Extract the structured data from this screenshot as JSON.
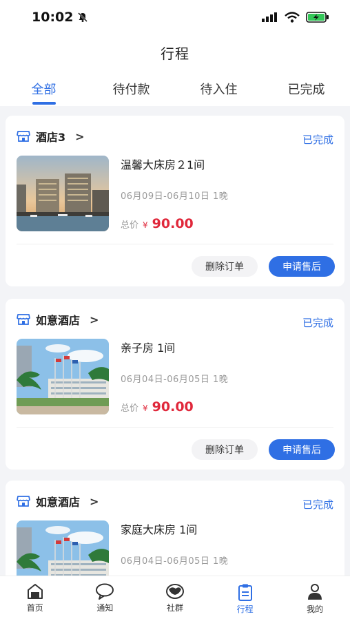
{
  "status_bar": {
    "time": "10:02"
  },
  "header": {
    "title": "行程"
  },
  "tabs": [
    {
      "label": "全部",
      "active": true
    },
    {
      "label": "待付款",
      "active": false
    },
    {
      "label": "待入住",
      "active": false
    },
    {
      "label": "已完成",
      "active": false
    }
  ],
  "orders": [
    {
      "hotel": "酒店3",
      "status": "已完成",
      "room": "温馨大床房２1间",
      "dates": "06月09日-06月10日 1晚",
      "price_label": "总价",
      "currency": "¥",
      "price": "90.00",
      "delete_label": "删除订单",
      "after_sale_label": "申请售后",
      "image": "hotel-towers-waterfront"
    },
    {
      "hotel": "如意酒店",
      "status": "已完成",
      "room": "亲子房 1间",
      "dates": "06月04日-06月05日 1晚",
      "price_label": "总价",
      "currency": "¥",
      "price": "90.00",
      "delete_label": "删除订单",
      "after_sale_label": "申请售后",
      "image": "hotel-palms-flags"
    },
    {
      "hotel": "如意酒店",
      "status": "已完成",
      "room": "家庭大床房 1间",
      "dates": "06月04日-06月05日 1晚",
      "image": "hotel-palms-flags"
    }
  ],
  "tabbar": [
    {
      "label": "首页",
      "icon": "home-icon",
      "active": false
    },
    {
      "label": "通知",
      "icon": "chat-bubble-icon",
      "active": false
    },
    {
      "label": "社群",
      "icon": "community-icon",
      "active": false
    },
    {
      "label": "行程",
      "icon": "clipboard-icon",
      "active": true
    },
    {
      "label": "我的",
      "icon": "person-icon",
      "active": false
    }
  ],
  "colors": {
    "accent": "#2f6fe4",
    "price": "#e0283b"
  }
}
